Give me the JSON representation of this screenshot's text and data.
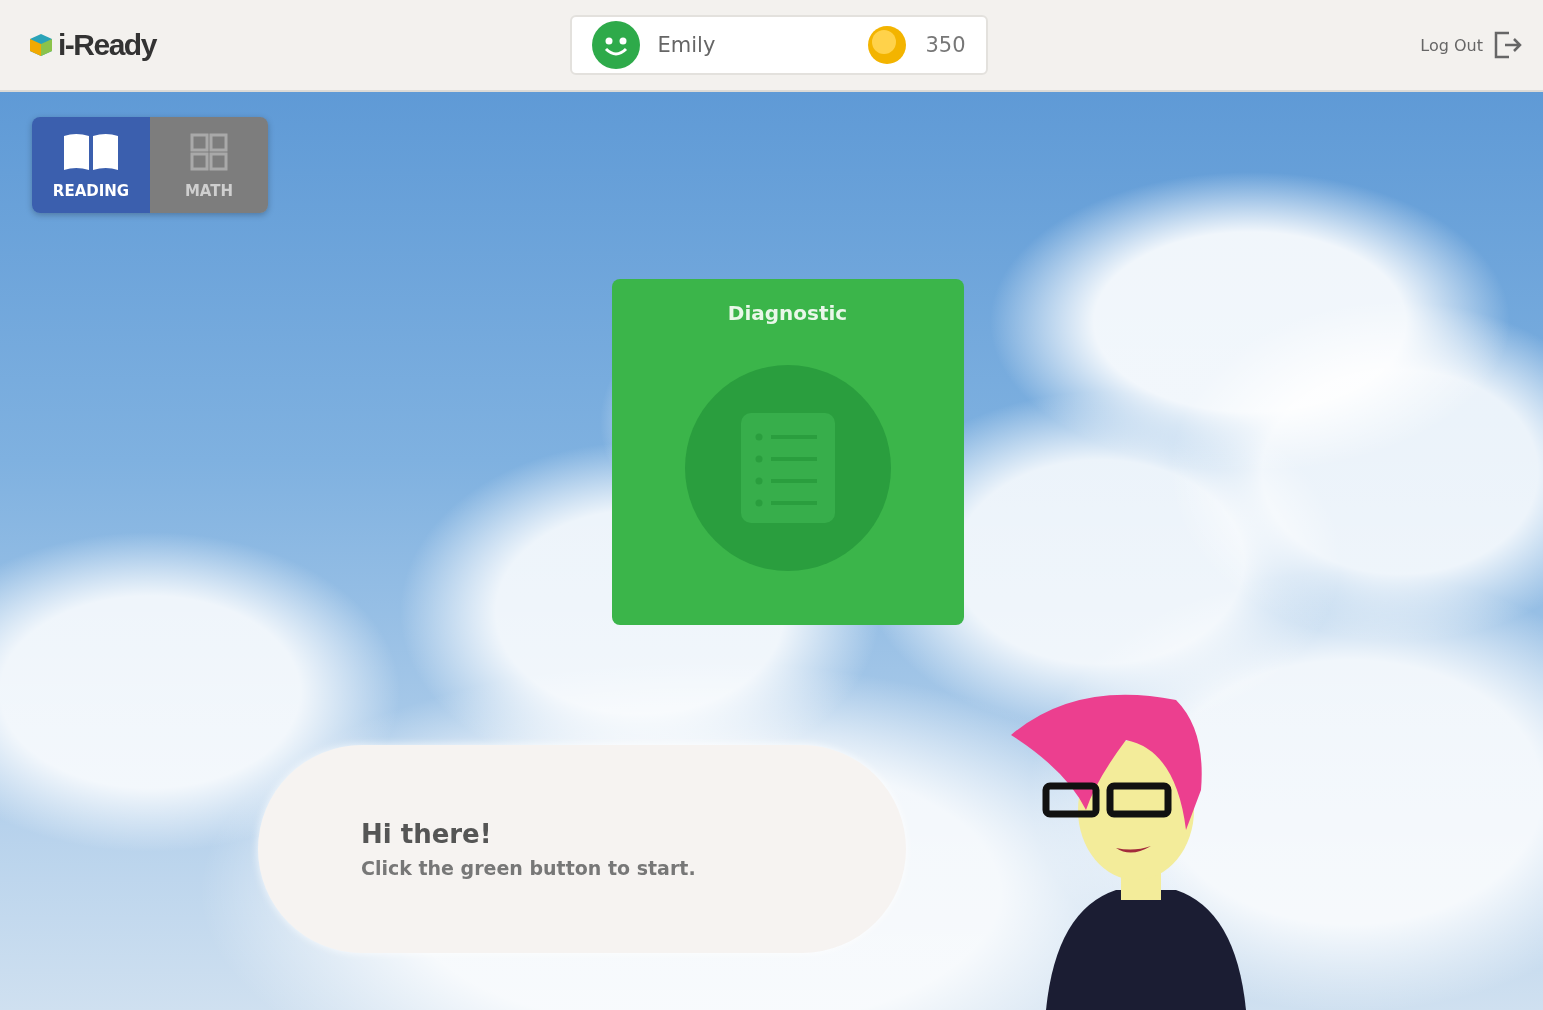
{
  "header": {
    "logo": "i-Ready",
    "user": {
      "name": "Emily"
    },
    "coins": "350",
    "logout": "Log Out"
  },
  "subject_tabs": [
    {
      "label": "READING",
      "selected": true
    },
    {
      "label": "MATH",
      "selected": false
    }
  ],
  "card": {
    "title": "Diagnostic"
  },
  "speech_bubble": {
    "title": "Hi there!",
    "message": "Click the green button to start."
  }
}
